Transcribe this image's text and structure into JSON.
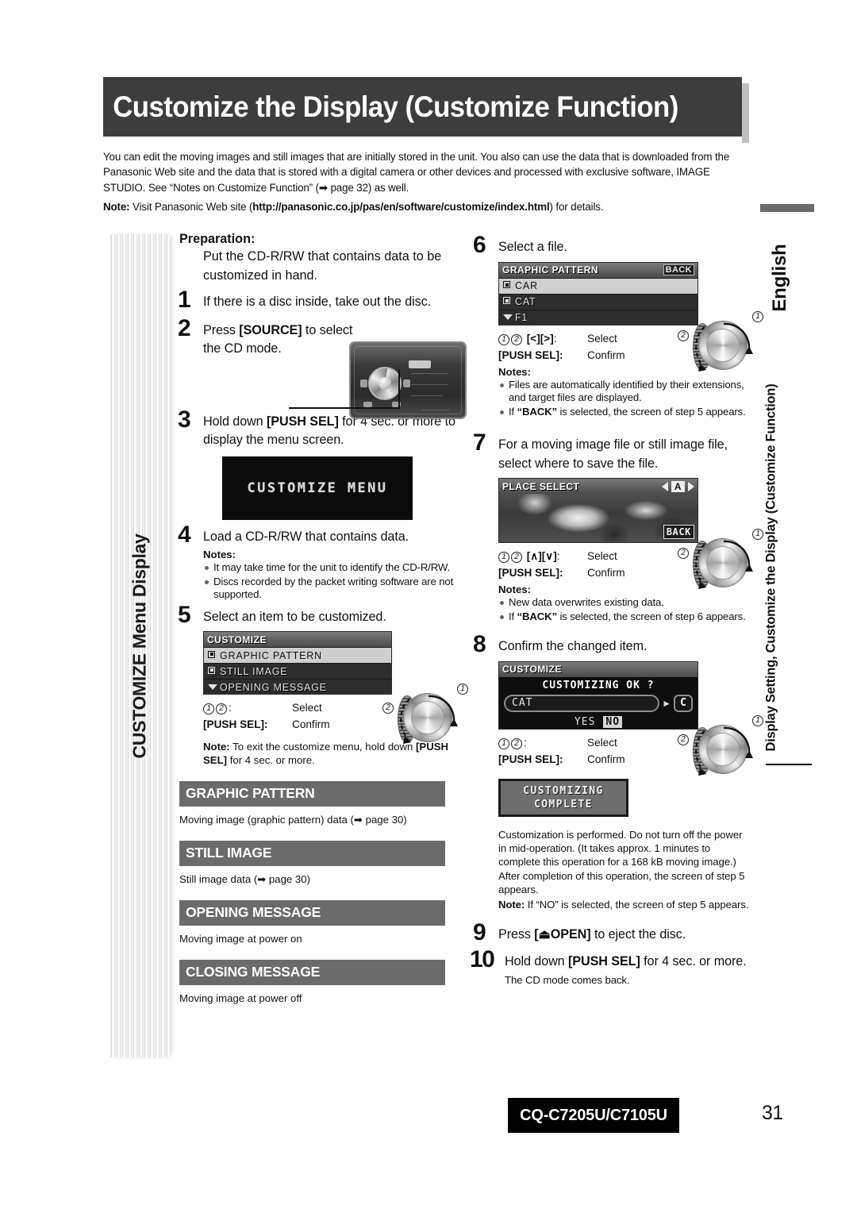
{
  "header": {
    "title": "Customize the Display (Customize Function)",
    "intro_p1": "You can edit the moving images and still images that are initially stored in the unit. You also can use the data that is downloaded from the Panasonic Web site and the data that is stored with a digital camera or other devices and processed with exclusive software, IMAGE STUDIO. See “Notes on Customize Function” (➡ page 32) as well.",
    "note_label": "Note:",
    "note_text_pre": " Visit Panasonic Web site (",
    "note_url": "http://panasonic.co.jp/pas/en/software/customize/index.html",
    "note_text_post": ") for details."
  },
  "left_tab": {
    "label": "CUSTOMIZE Menu Display"
  },
  "right_sidebar": {
    "language": "English",
    "chapter": "Display Setting, Customize the Display (Customize Function)"
  },
  "preparation": {
    "heading": "Preparation:",
    "text": "Put the CD-R/RW that contains data to be customized in hand."
  },
  "steps": {
    "s1": {
      "num": "1",
      "text": "If there is a disc inside, take out the disc."
    },
    "s2": {
      "num": "2",
      "text_1": "Press ",
      "bold": "[SOURCE]",
      "text_2": " to select the CD mode."
    },
    "s3": {
      "num": "3",
      "text_1": "Hold down ",
      "bold": "[PUSH SEL]",
      "text_2": " for 4 sec. or more to display the menu screen."
    },
    "s4": {
      "num": "4",
      "text": "Load a CD-R/RW that contains data.",
      "notes_label": "Notes:",
      "notes": [
        "It may take time for the unit to identify the CD-R/RW.",
        "Discs recorded by the packet writing software are not supported."
      ]
    },
    "s5": {
      "num": "5",
      "text": "Select an item to be customized.",
      "note_label": "Note:",
      "note_text_1": " To exit the customize menu, hold down ",
      "note_bold": "[PUSH SEL]",
      "note_text_2": " for 4 sec. or more."
    },
    "s6": {
      "num": "6",
      "text": "Select a file."
    },
    "s7": {
      "num": "7",
      "text": "For a moving image file or still image file, select where to save the file."
    },
    "s8": {
      "num": "8",
      "text": "Confirm the changed item.",
      "paragraph": "Customization is performed. Do not turn off the power in mid-operation. (It takes approx. 1 minutes to complete this operation for a 168 kB moving image.) After completion of this operation, the screen of step 5 appears.",
      "note_label": "Note:",
      "note_text": " If “NO” is selected, the screen of step 5 appears."
    },
    "s9": {
      "num": "9",
      "text_1": "Press ",
      "bold": "[⏏OPEN]",
      "text_2": " to eject the disc."
    },
    "s10": {
      "num": "10",
      "text_1": "Hold down ",
      "bold": "[PUSH SEL]",
      "text_2": " for 4 sec. or more.",
      "sub": "The CD mode comes back."
    }
  },
  "lcd": {
    "menu_screen": {
      "text": "CUSTOMIZE MENU"
    },
    "customize_list": {
      "title": "CUSTOMIZE",
      "rows": [
        {
          "mark": "box-filled",
          "label": "GRAPHIC PATTERN",
          "selected": true
        },
        {
          "mark": "box-filled",
          "label": "STILL IMAGE",
          "selected": false
        },
        {
          "mark": "triangle-down",
          "label": "OPENING MESSAGE",
          "selected": false
        }
      ]
    },
    "graphic_pattern_list": {
      "title": "GRAPHIC PATTERN",
      "back": "BACK",
      "rows": [
        {
          "mark": "box-filled",
          "label": "CAR",
          "selected": true
        },
        {
          "mark": "box-filled",
          "label": "CAT",
          "selected": false
        },
        {
          "mark": "triangle-down",
          "label": "F1",
          "selected": false
        }
      ]
    },
    "place_select": {
      "title": "PLACE SELECT",
      "slot": "A",
      "back": "BACK"
    },
    "confirm": {
      "title": "CUSTOMIZE",
      "question": "CUSTOMIZING OK ?",
      "field_value": "CAT",
      "chip": "C",
      "yes": "YES",
      "no": "NO"
    },
    "complete": {
      "line1": "CUSTOMIZING",
      "line2": "COMPLETE"
    }
  },
  "key_legend": {
    "select_label": "Select",
    "confirm_label": "Confirm",
    "push_sel": "[PUSH SEL]",
    "colon": ":",
    "marker_1": "1",
    "marker_2": "2",
    "lr_keys": "[<][>]",
    "ud_keys": "[∧][∨]"
  },
  "sections": [
    {
      "title": "GRAPHIC PATTERN",
      "desc": "Moving image (graphic pattern) data (➡ page 30)"
    },
    {
      "title": "STILL IMAGE",
      "desc": "Still image data (➡ page 30)"
    },
    {
      "title": "OPENING MESSAGE",
      "desc": "Moving image at power on"
    },
    {
      "title": "CLOSING MESSAGE",
      "desc": "Moving image at power off"
    }
  ],
  "footer": {
    "model": "CQ-C7205U/C7105U",
    "page": "31"
  }
}
